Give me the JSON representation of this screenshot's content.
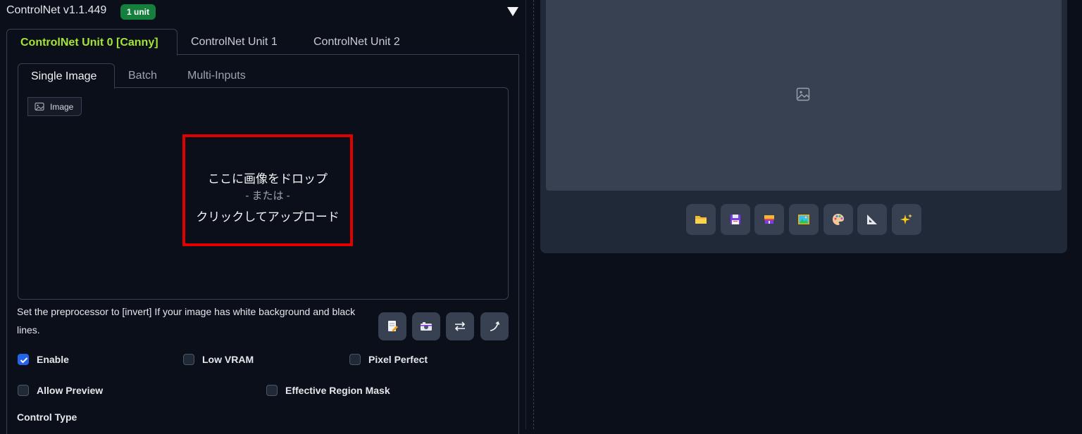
{
  "controlnet": {
    "title": "ControlNet v1.1.449",
    "badge": "1 unit",
    "unit_tabs": [
      {
        "label": "ControlNet Unit 0 [Canny]",
        "active": true
      },
      {
        "label": "ControlNet Unit 1",
        "active": false
      },
      {
        "label": "ControlNet Unit 2",
        "active": false
      }
    ],
    "input_tabs": [
      {
        "label": "Single Image",
        "active": true
      },
      {
        "label": "Batch",
        "active": false
      },
      {
        "label": "Multi-Inputs",
        "active": false
      }
    ],
    "image_label": "Image",
    "drop_zone": {
      "line1": "ここに画像をドロップ",
      "line2": "- または -",
      "line3": "クリックしてアップロード"
    },
    "hint": "Set the preprocessor to [invert] If your image has white background and black lines.",
    "tool_buttons": [
      "edit-icon",
      "camera-icon",
      "swap-icon",
      "curve-icon"
    ],
    "checkboxes": [
      {
        "label": "Enable",
        "checked": true
      },
      {
        "label": "Low VRAM",
        "checked": false
      },
      {
        "label": "Pixel Perfect",
        "checked": false
      },
      {
        "label": "Allow Preview",
        "checked": false
      },
      {
        "label": "Effective Region Mask",
        "checked": false
      }
    ],
    "control_type_label": "Control Type"
  },
  "gallery": {
    "placeholder_icon": "image-icon",
    "action_buttons": [
      "folder-icon",
      "save-icon",
      "zip-icon",
      "image-icon",
      "palette-icon",
      "ruler-icon",
      "sparkles-icon"
    ]
  },
  "colors": {
    "background": "#0b0f19",
    "panel": "#1f2937",
    "accent_green": "#a3e635",
    "badge_green": "#15803d",
    "highlight_red": "#e00000",
    "checkbox_blue": "#2563eb"
  }
}
